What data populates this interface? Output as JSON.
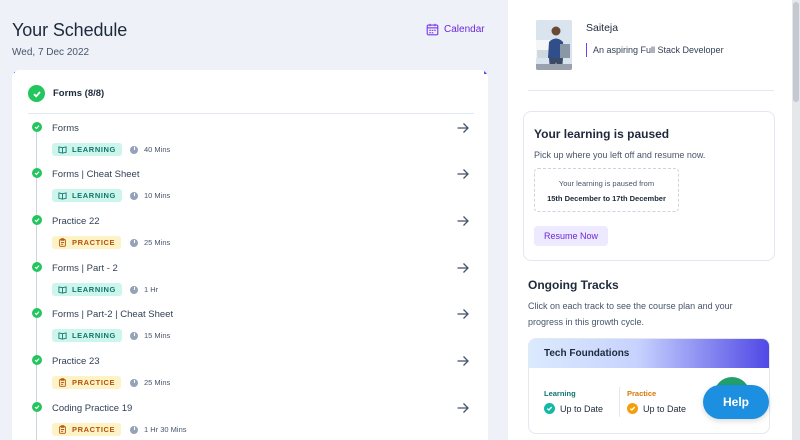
{
  "schedule": {
    "title": "Your Schedule",
    "date": "Wed, 7 Dec 2022",
    "calendar_label": "Calendar",
    "module_title": "Forms (8/8)",
    "items": [
      {
        "title": "Forms",
        "tag": "LEARNING",
        "type": "learning",
        "duration": "40 Mins"
      },
      {
        "title": "Forms | Cheat Sheet",
        "tag": "LEARNING",
        "type": "learning",
        "duration": "10 Mins"
      },
      {
        "title": "Practice 22",
        "tag": "PRACTICE",
        "type": "practice",
        "duration": "25 Mins"
      },
      {
        "title": "Forms | Part - 2",
        "tag": "LEARNING",
        "type": "learning",
        "duration": "1 Hr"
      },
      {
        "title": "Forms | Part-2 | Cheat Sheet",
        "tag": "LEARNING",
        "type": "learning",
        "duration": "15 Mins"
      },
      {
        "title": "Practice 23",
        "tag": "PRACTICE",
        "type": "practice",
        "duration": "25 Mins"
      },
      {
        "title": "Coding Practice 19",
        "tag": "PRACTICE",
        "type": "practice",
        "duration": "1 Hr 30 Mins"
      }
    ]
  },
  "profile": {
    "name": "Saiteja",
    "bio": "An aspiring Full Stack Developer"
  },
  "paused": {
    "title": "Your learning is paused",
    "subtitle": "Pick up where you left off and resume now.",
    "box_line1": "Your learning is paused from",
    "box_line2": "15th December to 17th December",
    "resume_label": "Resume Now"
  },
  "ongoing": {
    "title": "Ongoing Tracks",
    "description": "Click on each track to see the course plan and your progress in this growth cycle.",
    "track": {
      "name": "Tech Foundations",
      "learning_label": "Learning",
      "learning_status": "Up to Date",
      "practice_label": "Practice",
      "practice_status": "Up to Date"
    }
  },
  "help_label": "Help",
  "colors": {
    "accent": "#7c3aed",
    "success": "#22c55e",
    "learning": "#0f766e",
    "practice": "#b45309",
    "help": "#1d8fe0"
  }
}
